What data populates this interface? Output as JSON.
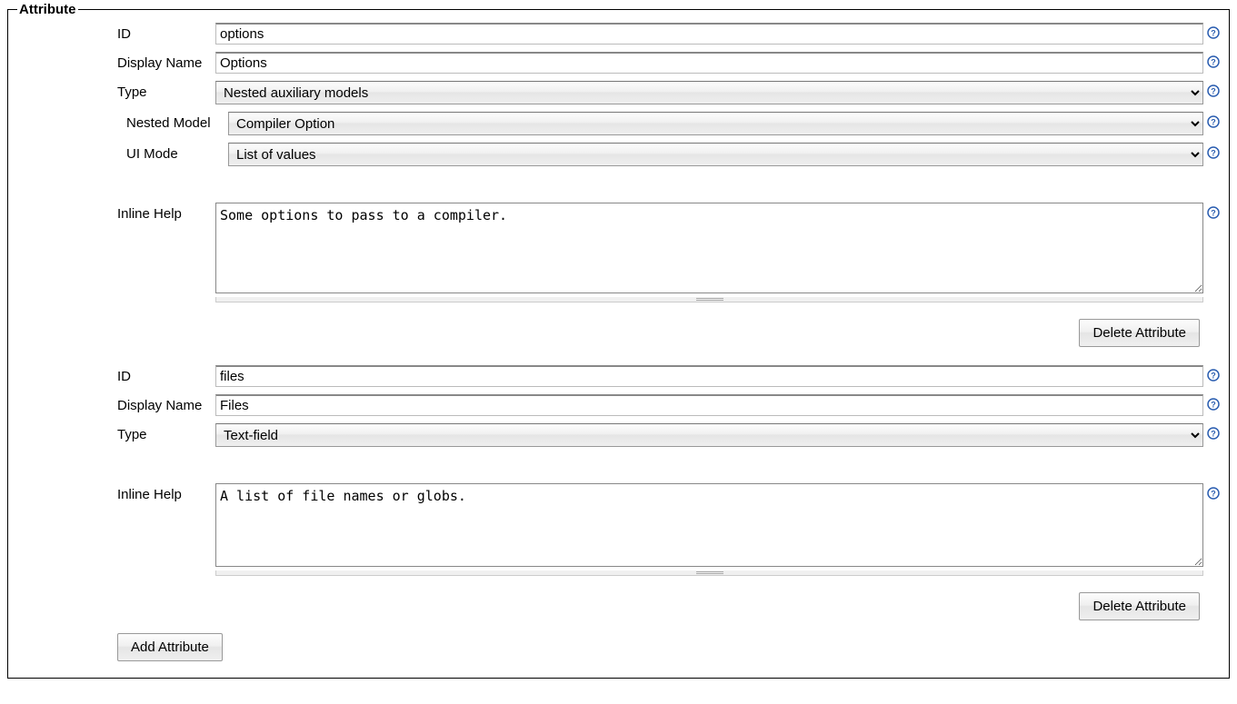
{
  "legend": "Attribute",
  "labels": {
    "id": "ID",
    "display_name": "Display Name",
    "type": "Type",
    "nested_model": "Nested Model",
    "ui_mode": "UI Mode",
    "inline_help": "Inline Help"
  },
  "buttons": {
    "delete_attribute": "Delete Attribute",
    "add_attribute": "Add Attribute"
  },
  "attributes": [
    {
      "id": "options",
      "display_name": "Options",
      "type": "Nested auxiliary models",
      "nested_model": "Compiler Option",
      "ui_mode": "List of values",
      "inline_help": "Some options to pass to a compiler."
    },
    {
      "id": "files",
      "display_name": "Files",
      "type": "Text-field",
      "inline_help": "A list of file names or globs."
    }
  ]
}
